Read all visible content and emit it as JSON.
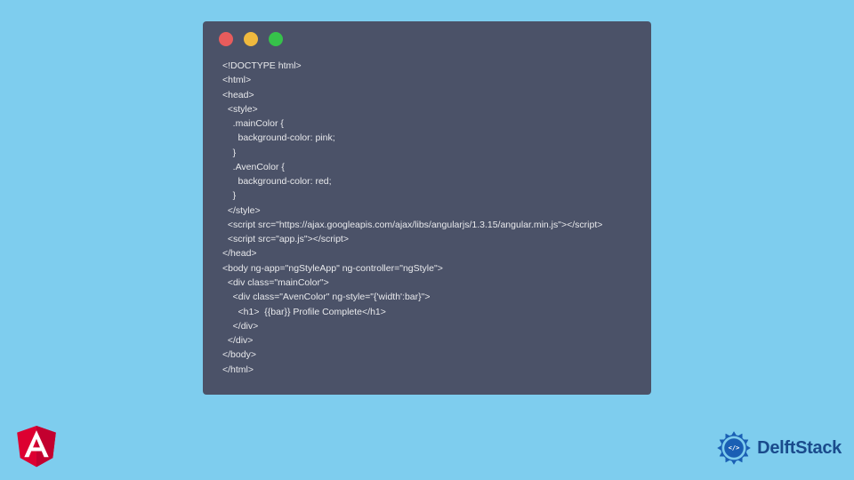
{
  "code_lines": [
    "<!DOCTYPE html>",
    "<html>",
    "<head>",
    "  <style>",
    "    .mainColor {",
    "      background-color: pink;",
    "    }",
    "    .AvenColor {",
    "      background-color: red;",
    "    }",
    "  </style>",
    "  <script src=\"https://ajax.googleapis.com/ajax/libs/angularjs/1.3.15/angular.min.js\"></script>",
    "  <script src=\"app.js\"></script>",
    "</head>",
    "<body ng-app=\"ngStyleApp\" ng-controller=\"ngStyle\">",
    "  <div class=\"mainColor\">",
    "    <div class=\"AvenColor\" ng-style=\"{'width':bar}\">",
    "      <h1>  {{bar}} Profile Complete</h1>",
    "    </div>",
    "  </div>",
    "</body>",
    "</html>"
  ],
  "brand": {
    "name": "DelftStack"
  },
  "window_controls": {
    "red": "close",
    "yellow": "minimize",
    "green": "maximize"
  }
}
